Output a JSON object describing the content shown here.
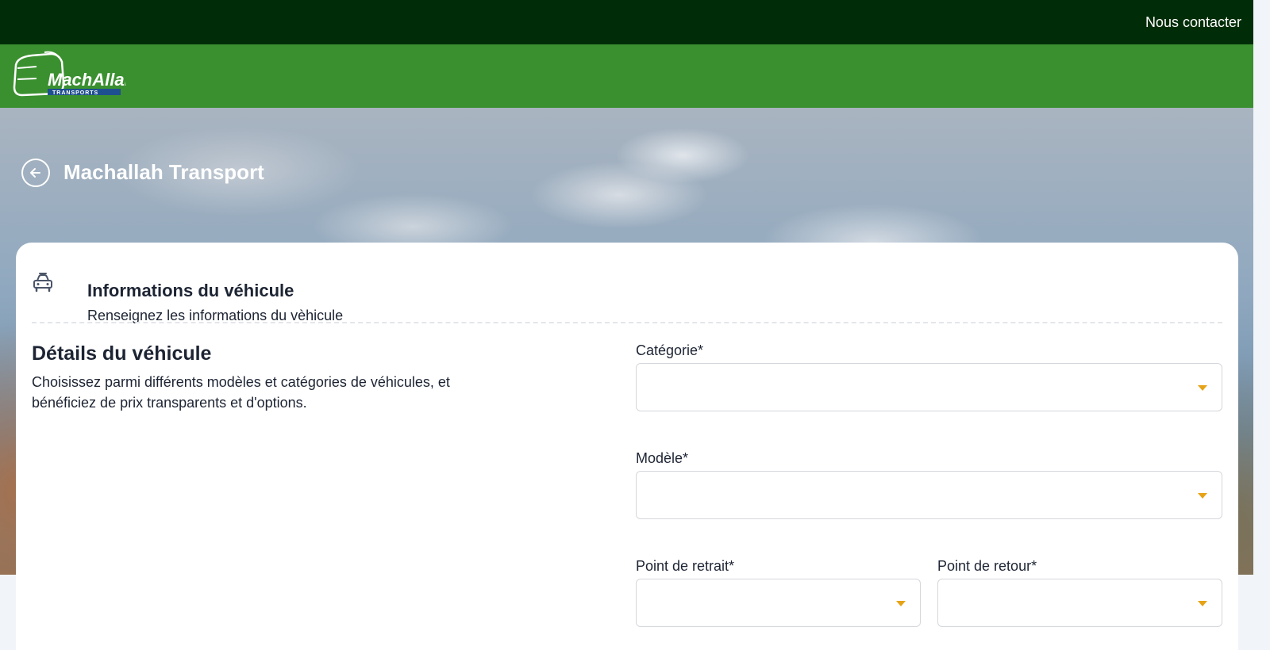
{
  "topbar": {
    "contact_label": "Nous contacter"
  },
  "brand": {
    "logo_text": "MachAllah",
    "logo_subtext": "TRANSPORTS"
  },
  "hero": {
    "title": "Machallah Transport"
  },
  "section": {
    "title": "Informations du véhicule",
    "subtitle": "Renseignez les informations du vèhicule"
  },
  "details": {
    "title": "Détails du véhicule",
    "description": "Choisissez parmi différents modèles et catégories de véhicules, et bénéficiez de prix transparents et d'options."
  },
  "form": {
    "categorie": {
      "label": "Catégorie*",
      "value": ""
    },
    "modele": {
      "label": "Modèle*",
      "value": ""
    },
    "retrait": {
      "label": "Point de retrait*",
      "value": ""
    },
    "retour": {
      "label": "Point de retour*",
      "value": ""
    }
  },
  "colors": {
    "topbar": "#002d08",
    "navbar": "#3a902f",
    "caret": "#e6a317"
  }
}
